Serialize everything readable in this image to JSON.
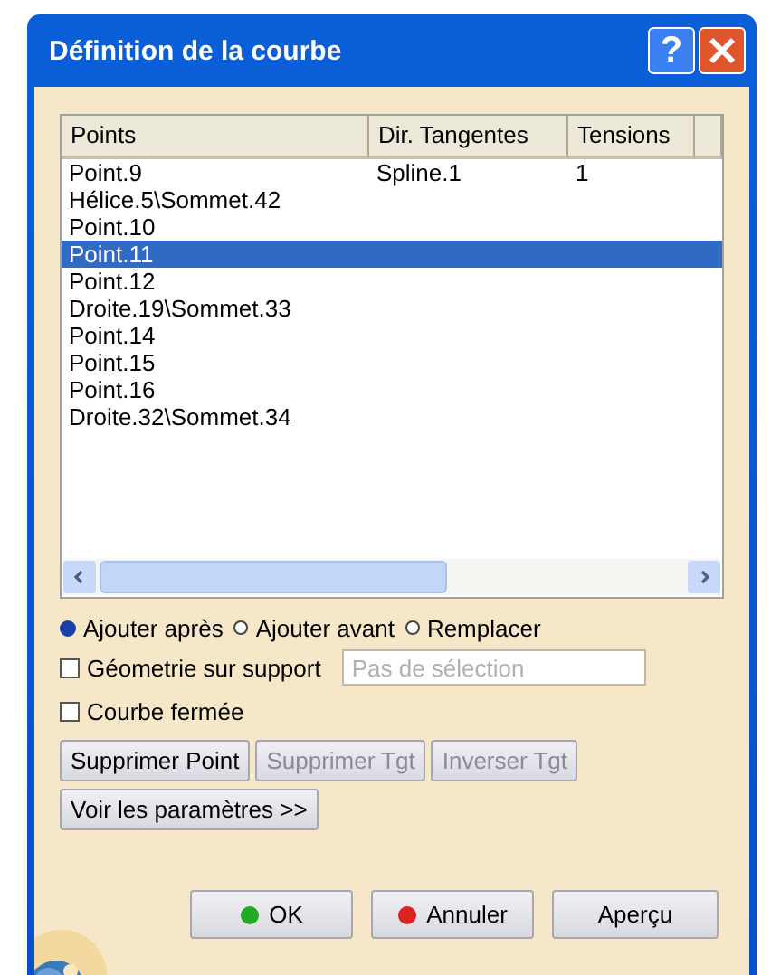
{
  "window": {
    "title": "Définition de la courbe",
    "help": "?"
  },
  "table": {
    "columns": [
      "Points",
      "Dir. Tangentes",
      "Tensions"
    ],
    "rows": [
      {
        "cells": [
          "Point.9",
          "Spline.1",
          "1"
        ],
        "selected": false
      },
      {
        "cells": [
          "Hélice.5\\Sommet.42",
          "",
          ""
        ],
        "selected": false
      },
      {
        "cells": [
          "Point.10",
          "",
          ""
        ],
        "selected": false
      },
      {
        "cells": [
          "Point.11",
          "",
          ""
        ],
        "selected": true
      },
      {
        "cells": [
          "Point.12",
          "",
          ""
        ],
        "selected": false
      },
      {
        "cells": [
          "Droite.19\\Sommet.33",
          "",
          ""
        ],
        "selected": false
      },
      {
        "cells": [
          "Point.14",
          "",
          ""
        ],
        "selected": false
      },
      {
        "cells": [
          "Point.15",
          "",
          ""
        ],
        "selected": false
      },
      {
        "cells": [
          "Point.16",
          "",
          ""
        ],
        "selected": false
      },
      {
        "cells": [
          "Droite.32\\Sommet.34",
          "",
          ""
        ],
        "selected": false
      }
    ]
  },
  "insert_mode": [
    {
      "label": "Ajouter après",
      "selected": true
    },
    {
      "label": "Ajouter avant",
      "selected": false
    },
    {
      "label": "Remplacer",
      "selected": false
    }
  ],
  "support": {
    "label": "Géometrie sur support",
    "checked": false,
    "placeholder": "Pas de sélection"
  },
  "closed_curve": {
    "label": "Courbe fermée",
    "checked": false
  },
  "action_buttons": [
    {
      "label": "Supprimer Point",
      "disabled": false
    },
    {
      "label": "Supprimer Tgt",
      "disabled": true
    },
    {
      "label": "Inverser Tgt",
      "disabled": true
    }
  ],
  "parameters_button": "Voir les paramètres >>",
  "dialog_buttons": [
    {
      "label": "OK",
      "color": "#22aa22"
    },
    {
      "label": "Annuler",
      "color": "#dd2222"
    },
    {
      "label": "Aperçu"
    }
  ]
}
